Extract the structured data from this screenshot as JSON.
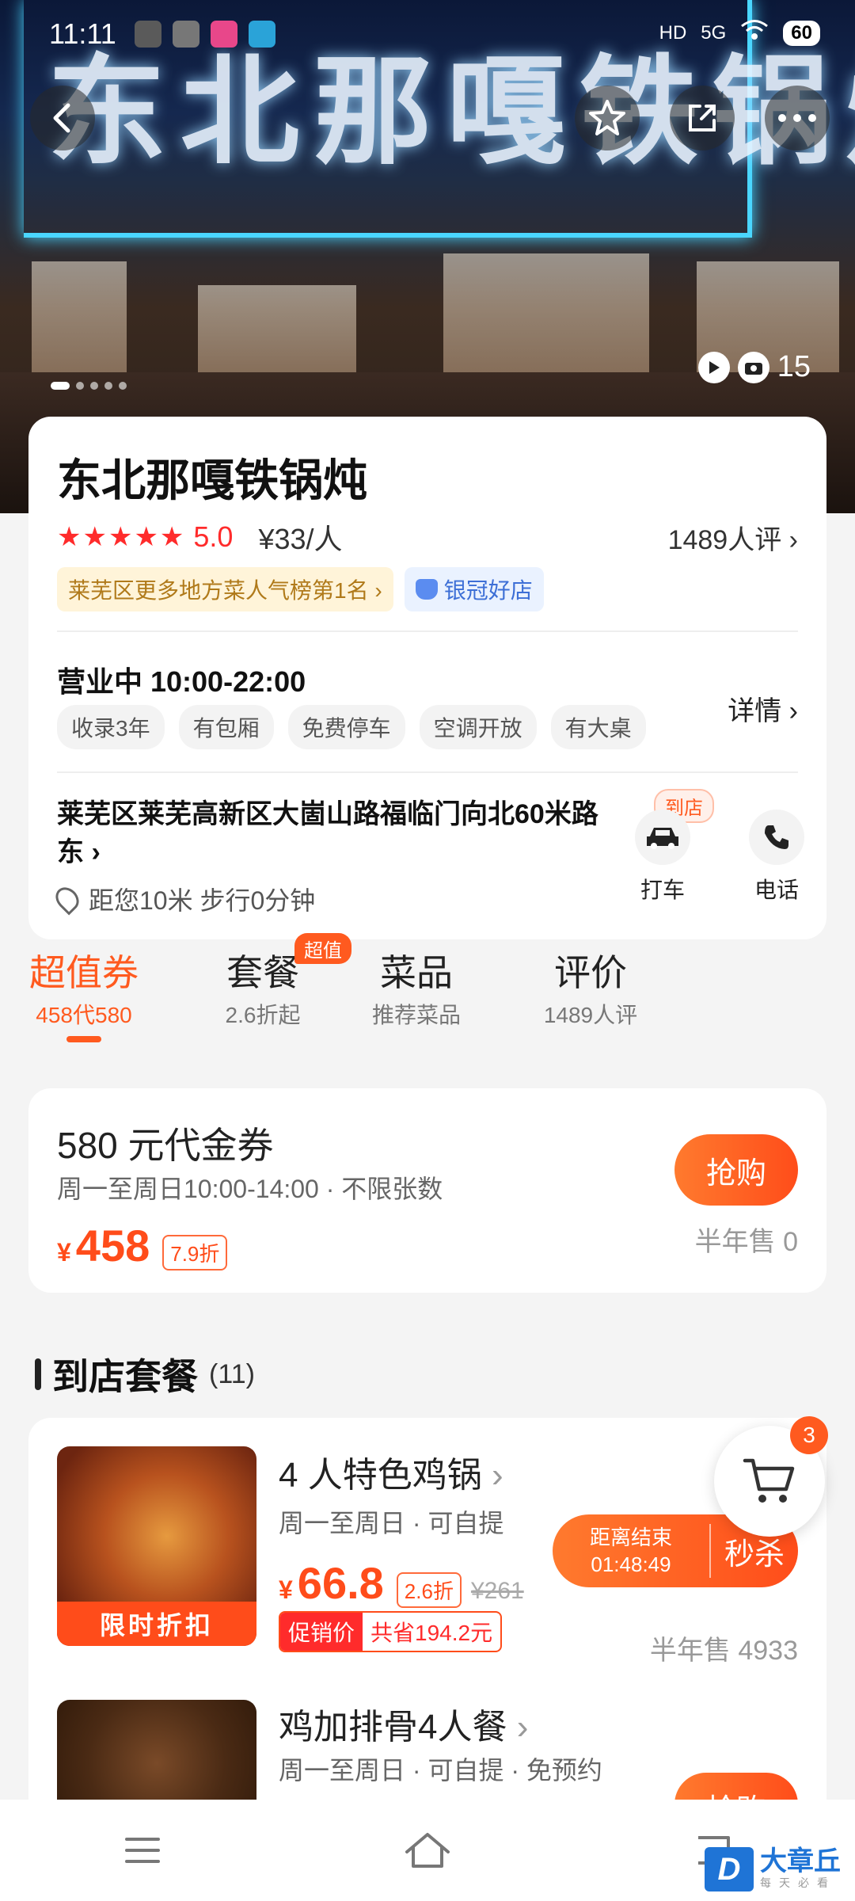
{
  "status_bar": {
    "time": "11:11",
    "battery": "60",
    "network": "5G"
  },
  "hero": {
    "photo_count": "15"
  },
  "shop": {
    "name": "东北那嘎铁锅炖",
    "stars": "★★★★★",
    "score": "5.0",
    "price": "¥33/人",
    "reviews": "1489人评",
    "rank_badge": "莱芜区更多地方菜人气榜第1名",
    "silver_badge": "银冠好店",
    "hours": "营业中 10:00-22:00",
    "tags": [
      "收录3年",
      "有包厢",
      "免费停车",
      "空调开放",
      "有大桌"
    ],
    "details": "详情",
    "address": "莱芜区莱芜高新区大崮山路福临门向北60米路东",
    "distance": "距您10米 步行0分钟",
    "to_store": "到店",
    "taxi": "打车",
    "phone": "电话"
  },
  "tabs": [
    {
      "title": "超值券",
      "sub": "458代580"
    },
    {
      "title": "套餐",
      "sub": "2.6折起",
      "badge": "超值"
    },
    {
      "title": "菜品",
      "sub": "推荐菜品"
    },
    {
      "title": "评价",
      "sub": "1489人评"
    }
  ],
  "voucher": {
    "title": "580 元代金券",
    "usage": "周一至周日10:00-14:00 · 不限张数",
    "yen": "¥",
    "price": "458",
    "discount": "7.9折",
    "buy": "抢购",
    "sold": "半年售 0"
  },
  "section": {
    "title": "到店套餐",
    "count": "(11)"
  },
  "packages": [
    {
      "name": "4 人特色鸡锅",
      "meta": "周一至周日 · 可自提",
      "ribbon": "限时折扣",
      "yen": "¥",
      "price": "66.8",
      "discount": "2.6折",
      "old_price": "¥261",
      "promo_label": "促销价",
      "promo_save": "共省194.2元",
      "countdown_label": "距离结束",
      "countdown": "01:48:49",
      "flash": "秒杀",
      "sold": "半年售 4933"
    },
    {
      "name": "鸡加排骨4人餐",
      "meta": "周一至周日 · 可自提 · 免预约",
      "buy": "抢购"
    }
  ],
  "cart": {
    "count": "3"
  },
  "watermark": {
    "brand": "大章丘",
    "sub": "每天必看"
  }
}
